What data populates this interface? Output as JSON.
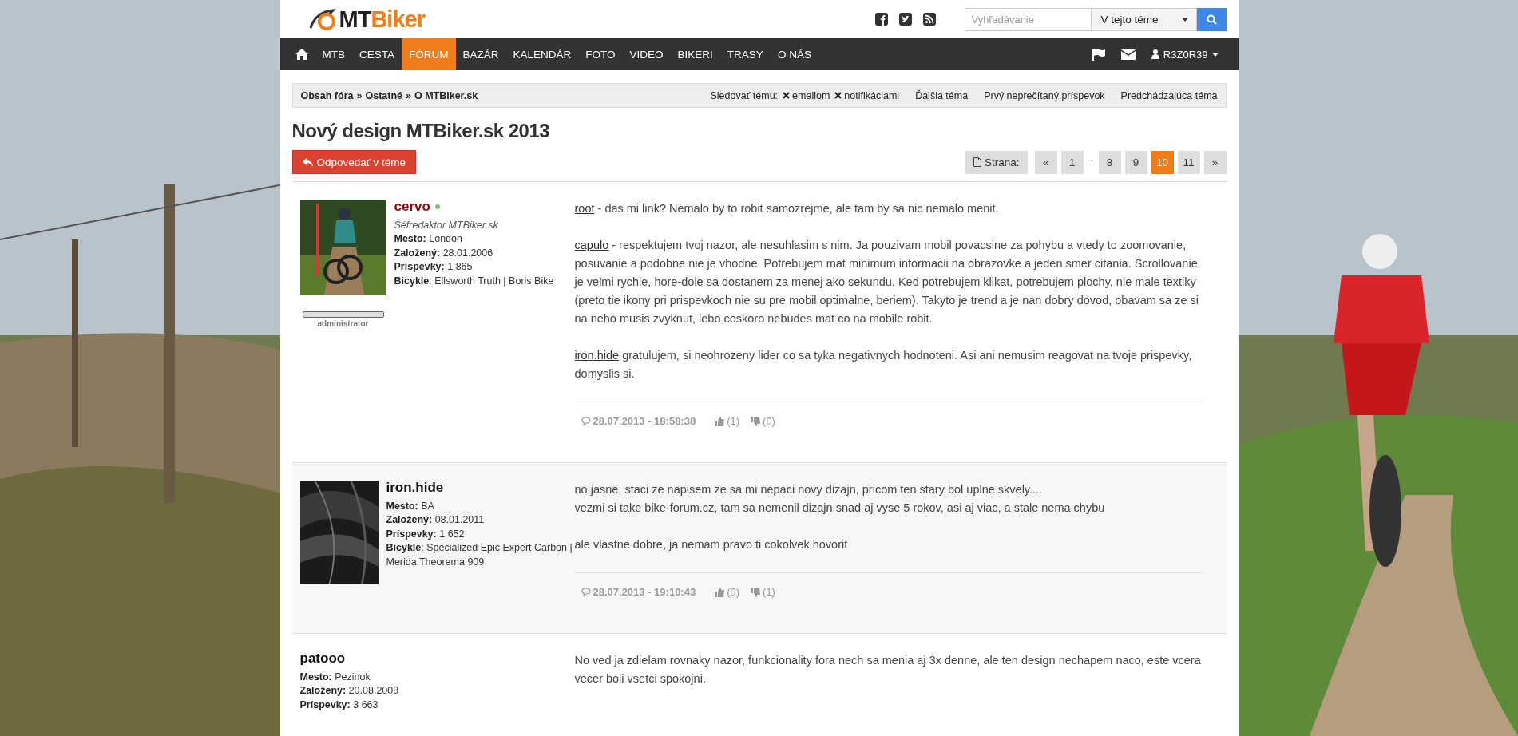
{
  "header": {
    "logo": {
      "dark": "MT",
      "accent": "Biker"
    },
    "search": {
      "placeholder": "Vyhľadávanie"
    },
    "scope": {
      "value": "V tejto téme"
    }
  },
  "nav": {
    "items": [
      {
        "kind": "home",
        "selected": false
      },
      {
        "label": "MTB",
        "selected": false
      },
      {
        "label": "CESTA",
        "selected": false
      },
      {
        "label": "FÓRUM",
        "selected": true
      },
      {
        "label": "BAZÁR",
        "selected": false
      },
      {
        "label": "KALENDÁR",
        "selected": false
      },
      {
        "label": "FOTO",
        "selected": false
      },
      {
        "label": "VIDEO",
        "selected": false
      },
      {
        "label": "BIKERI",
        "selected": false
      },
      {
        "label": "TRASY",
        "selected": false
      },
      {
        "label": "O NÁS",
        "selected": false
      }
    ],
    "user": "R3Z0R39"
  },
  "breadcrumbs": {
    "items": [
      "Obsah fóra",
      "Ostatné",
      "O MTBiker.sk"
    ],
    "separator": "»"
  },
  "topic_actions": {
    "watch_label": "Sledovať tému:",
    "watch": [
      "emailom",
      "notifikáciami"
    ],
    "links": [
      "Ďalšia téma",
      "Prvý neprečítaný príspevok",
      "Predchádzajúca téma"
    ]
  },
  "title": "Nový design MTBiker.sk 2013",
  "reply_button": "Odpovedať v téme",
  "pagination": {
    "label": "Strana:",
    "items": [
      {
        "kind": "page",
        "label": "«",
        "selected": false
      },
      {
        "kind": "page",
        "label": "1",
        "selected": false
      },
      {
        "kind": "gap",
        "label": "···"
      },
      {
        "kind": "page",
        "label": "8",
        "selected": false
      },
      {
        "kind": "page",
        "label": "9",
        "selected": false
      },
      {
        "kind": "page",
        "label": "10",
        "selected": true
      },
      {
        "kind": "page",
        "label": "11",
        "selected": false
      },
      {
        "kind": "page",
        "label": "»",
        "selected": false
      }
    ]
  },
  "posts": [
    {
      "author": "cervo",
      "color": "#990000",
      "online": true,
      "avatar": {
        "kind": "picture"
      },
      "role": "Šéfredaktor MTBiker.sk",
      "rank": "administrator",
      "fields": [
        "**Mesto:** London",
        "**Založený:** 28.01.2006",
        "**Príspevky:** 1 865",
        "**Bicykle**: Ellsworth Truth | Boris Bike"
      ],
      "blocks": [
        [
          {
            "link": "root",
            "text": " - das mi link? Nemalo by to robit samozrejme, ale tam by sa nic nemalo menit."
          }
        ],
        [
          {
            "link": "capulo",
            "text": " - respektujem tvoj nazor, ale nesuhlasim s nim. Ja pouzivam mobil povacsine za pohybu a vtedy to zoomovanie, posuvanie a podobne nie je vhodne. Potrebujem mat minimum informacii na obrazovke a jeden smer citania. Scrollovanie je velmi rychle, hore-dole sa dostanem za menej ako sekundu. Ked potrebujem klikat, potrebujem plochy, nie male textiky (preto tie ikony pri prispevkoch nie su pre mobil optimalne, beriem). Takyto je trend a je nan dobry dovod, obavam sa ze si na neho musis zvyknut, lebo coskoro nebudes mat co na mobile robit."
          }
        ],
        [
          {
            "link": "iron.hide",
            "text": " gratulujem, si neohrozeny lider co sa tyka negativnych hodnoteni. Asi ani nemusim reagovat na tvoje prispevky, domyslis si."
          }
        ]
      ],
      "date": "28.07.2013 - 18:58:38",
      "likes": "(1)",
      "dislikes": "(0)"
    },
    {
      "author": "iron.hide",
      "color": "#111111",
      "avatar": {
        "kind": "picture"
      },
      "fields": [
        "**Mesto:** BA",
        "**Založený:** 08.01.2011",
        "**Príspevky:** 1 652",
        "**Bicykle**: Specialized Epic Expert Carbon | Merida Theorema 909"
      ],
      "blocks": [
        [
          {
            "text": "no jasne, staci ze napisem ze sa mi nepaci novy dizajn, pricom ten stary bol uplne skvely...."
          },
          {
            "text": "vezmi si take bike-forum.cz, tam sa nemenil dizajn snad aj vyse 5 rokov, asi aj viac, a stale nema chybu"
          }
        ],
        [
          {
            "text": "ale vlastne dobre, ja nemam pravo ti cokolvek hovorit"
          }
        ]
      ],
      "date": "28.07.2013 - 19:10:43",
      "likes": "(0)",
      "dislikes": "(1)"
    },
    {
      "author": "patooo",
      "color": "#111111",
      "fields": [
        "**Mesto:** Pezinok",
        "**Založený:** 20.08.2008",
        "**Príspevky:** 3 663"
      ],
      "blocks": [
        [
          {
            "text": "No ved ja zdielam rovnaky nazor, funkcionality fora nech sa menia aj 3x denne, ale ten design nechapem naco, este vcera vecer boli vsetci spokojni."
          }
        ]
      ]
    }
  ]
}
